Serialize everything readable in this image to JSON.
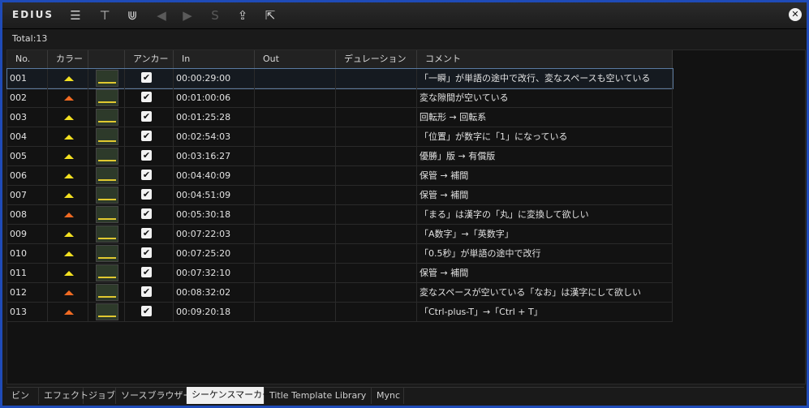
{
  "toolbar": {
    "brand": "EDIUS",
    "icons": [
      {
        "name": "marker-list-icon",
        "glyph": "☰"
      },
      {
        "name": "pin-icon",
        "glyph": "⊤"
      },
      {
        "name": "marker-split-icon",
        "glyph": "⋓"
      },
      {
        "name": "previous-marker-icon",
        "glyph": "◀"
      },
      {
        "name": "next-marker-icon",
        "glyph": "▶"
      },
      {
        "name": "clear-marker-icon",
        "glyph": "S"
      },
      {
        "name": "import-icon",
        "glyph": "⇪"
      },
      {
        "name": "export-icon",
        "glyph": "⇱"
      }
    ],
    "close_glyph": "✕"
  },
  "summary": {
    "total": "Total:13"
  },
  "table": {
    "headers": [
      "No.",
      "カラー",
      "",
      "アンカー",
      "In",
      "Out",
      "デュレーション",
      "コメント"
    ],
    "rows": [
      {
        "no": "001",
        "color": "yellow",
        "anchor": true,
        "in": "00:00:29:00",
        "out": "",
        "duration": "",
        "comment": "「一瞬」が単語の途中で改行、変なスペースも空いている",
        "selected": true
      },
      {
        "no": "002",
        "color": "orange",
        "anchor": true,
        "in": "00:01:00:06",
        "out": "",
        "duration": "",
        "comment": "変な隙間が空いている"
      },
      {
        "no": "003",
        "color": "yellow",
        "anchor": true,
        "in": "00:01:25:28",
        "out": "",
        "duration": "",
        "comment": "回転形 → 回転系"
      },
      {
        "no": "004",
        "color": "yellow",
        "anchor": true,
        "in": "00:02:54:03",
        "out": "",
        "duration": "",
        "comment": "「位置」が数字に「1」になっている"
      },
      {
        "no": "005",
        "color": "yellow",
        "anchor": true,
        "in": "00:03:16:27",
        "out": "",
        "duration": "",
        "comment": "優勝」版 → 有償版"
      },
      {
        "no": "006",
        "color": "yellow",
        "anchor": true,
        "in": "00:04:40:09",
        "out": "",
        "duration": "",
        "comment": "保管 → 補間"
      },
      {
        "no": "007",
        "color": "yellow",
        "anchor": true,
        "in": "00:04:51:09",
        "out": "",
        "duration": "",
        "comment": "保管 → 補間"
      },
      {
        "no": "008",
        "color": "orange",
        "anchor": true,
        "in": "00:05:30:18",
        "out": "",
        "duration": "",
        "comment": "「まる」は漢字の「丸」に変換して欲しい"
      },
      {
        "no": "009",
        "color": "yellow",
        "anchor": true,
        "in": "00:07:22:03",
        "out": "",
        "duration": "",
        "comment": "「A数字」→「英数字」"
      },
      {
        "no": "010",
        "color": "yellow",
        "anchor": true,
        "in": "00:07:25:20",
        "out": "",
        "duration": "",
        "comment": "「0.5秒」が単語の途中で改行"
      },
      {
        "no": "011",
        "color": "yellow",
        "anchor": true,
        "in": "00:07:32:10",
        "out": "",
        "duration": "",
        "comment": "保管 → 補間"
      },
      {
        "no": "012",
        "color": "orange",
        "anchor": true,
        "in": "00:08:32:02",
        "out": "",
        "duration": "",
        "comment": "変なスペースが空いている「なお」は漢字にして欲しい"
      },
      {
        "no": "013",
        "color": "orange",
        "anchor": true,
        "in": "00:09:20:18",
        "out": "",
        "duration": "",
        "comment": "「Ctrl-plus-T」→「Ctrl + T」"
      }
    ]
  },
  "tabs": [
    {
      "label": "ビン",
      "active": false
    },
    {
      "label": "エフェクト",
      "active": false
    },
    {
      "label": "ジョブ",
      "active": false
    },
    {
      "label": "ソースブラウザー",
      "active": false
    },
    {
      "label": "シーケンスマーカー",
      "active": true
    },
    {
      "label": "Title Template Library",
      "active": false
    },
    {
      "label": "Mync",
      "active": false
    }
  ],
  "colors": {
    "yellow": "#f3e020",
    "orange": "#f06a22",
    "frame": "#1f4bb8"
  }
}
